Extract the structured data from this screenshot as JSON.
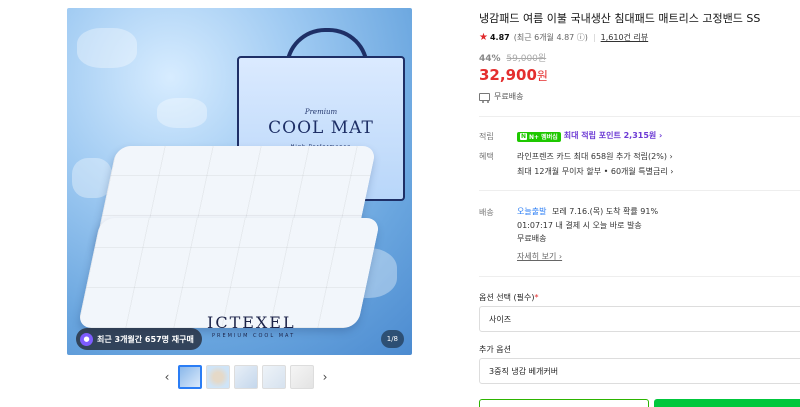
{
  "gallery": {
    "bag_small": "Premium",
    "bag_title": "COOL MAT",
    "bag_sub": "High Performance",
    "brand": "ICTEXEL",
    "brand_sub": "PREMIUM COOL MAT",
    "reorder_badge_icon": "purple-circle-icon",
    "reorder_text": "최근 3개월간 657명 재구매",
    "counter": "1/8",
    "prev_arrow": "‹",
    "next_arrow": "›"
  },
  "product": {
    "title": "냉감패드 여름 이불 국내생산 침대패드 매트리스 고정밴드 SS",
    "rating_score": "4.87",
    "rating_meta": "(최근 6개월 4.87 ⓘ)",
    "reviews": "1,610건 리뷰",
    "discount_pct": "44%",
    "original_price": "59,000원",
    "price": "32,900",
    "price_unit": "원",
    "free_shipping": "무료배송"
  },
  "benefits": {
    "points_label": "적립",
    "npay_badge": "N+ 멤버십",
    "points_text": "최대 적립 포인트 2,315원 ›",
    "benefit_label": "혜택",
    "benefit_line1": "라인프렌즈 카드 최대 658원 추가 적립(2%) ›",
    "benefit_line2": "최대 12개월 무이자 할부 • 60개월 특별금리 ›"
  },
  "delivery": {
    "label": "배송",
    "badge": "오늘출발",
    "line1": "모레 7.16.(목) 도착 확률 91%",
    "line2": "01:07:17  내 결제 시 오늘 바로 발송",
    "line3": "무료배송",
    "more": "자세히 보기 ›"
  },
  "options": {
    "label": "옵션 선택",
    "required_note": "(필수)",
    "required_mark": "*",
    "size_placeholder": "사이즈",
    "extra_label": "추가 옵션",
    "extra_value": "3중직 냉감 베개커버"
  },
  "colors": {
    "price_red": "#e42e2e",
    "naver_green": "#00c73c",
    "points_purple": "#6c3ad4",
    "delivery_blue": "#2a7df5"
  }
}
